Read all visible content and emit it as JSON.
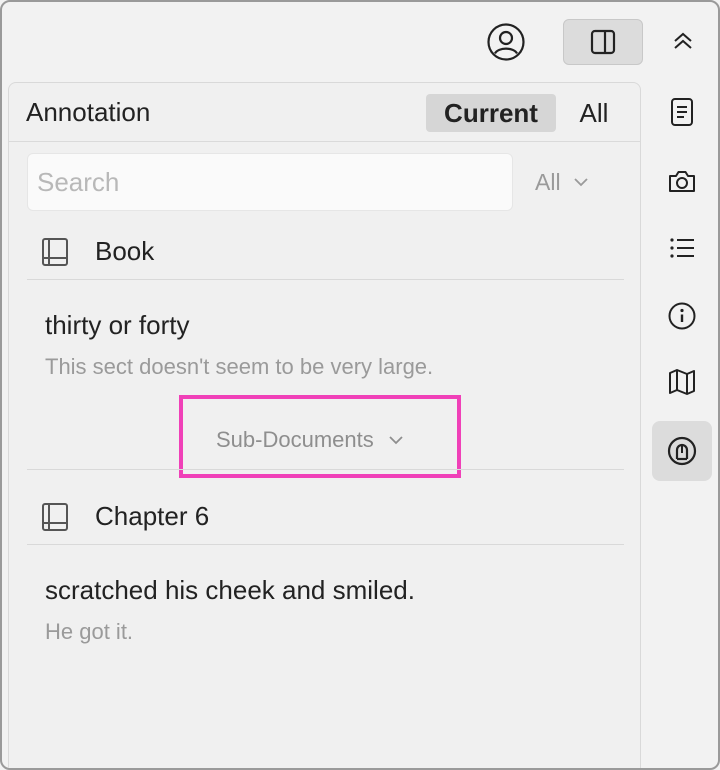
{
  "topbar": {
    "account_icon": "user-circle-icon",
    "sidebar_toggle_icon": "sidebar-toggle-icon",
    "collapse_icon": "chevron-double-up-icon"
  },
  "panel": {
    "title": "Annotation",
    "scope_tabs": [
      {
        "label": "Current",
        "selected": true
      },
      {
        "label": "All",
        "selected": false
      }
    ],
    "search": {
      "placeholder": "Search",
      "value": ""
    },
    "filter": {
      "selected": "All"
    }
  },
  "groups": [
    {
      "title": "Book",
      "icon": "book-icon",
      "notes": [
        {
          "text": "thirty or forty",
          "comment": "This sect doesn't seem to be very large."
        }
      ],
      "sub_documents_label": "Sub-Documents"
    },
    {
      "title": "Chapter 6",
      "icon": "book-icon",
      "notes": [
        {
          "text": "scratched his cheek and smiled.",
          "comment": "He got it."
        }
      ]
    }
  ],
  "rail": [
    {
      "name": "document",
      "icon": "document-icon",
      "active": false
    },
    {
      "name": "camera",
      "icon": "camera-icon",
      "active": false
    },
    {
      "name": "outline",
      "icon": "list-icon",
      "active": false
    },
    {
      "name": "info",
      "icon": "info-icon",
      "active": false
    },
    {
      "name": "map",
      "icon": "map-icon",
      "active": false
    },
    {
      "name": "annotation",
      "icon": "annotation-icon",
      "active": true
    }
  ],
  "colors": {
    "highlight": "#f040b8",
    "active_bg": "#dcdcdc"
  }
}
